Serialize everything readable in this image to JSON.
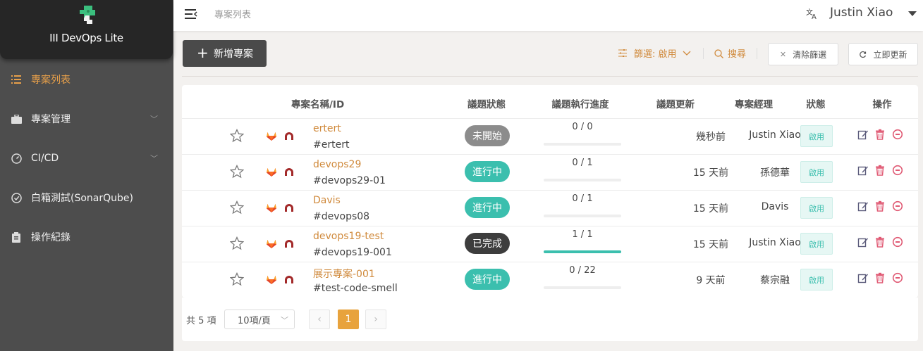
{
  "app": {
    "title": "III DevOps Lite"
  },
  "sidebar": {
    "items": [
      {
        "label": "專案列表",
        "icon": "list-icon",
        "active": true
      },
      {
        "label": "專案管理",
        "icon": "briefcase-icon",
        "expandable": true
      },
      {
        "label": "CI/CD",
        "icon": "gauge-icon",
        "expandable": true
      },
      {
        "label": "白箱測試(SonarQube)",
        "icon": "check-circle-icon"
      },
      {
        "label": "操作紀錄",
        "icon": "clipboard-icon"
      }
    ]
  },
  "header": {
    "breadcrumb": "專案列表",
    "user": "Justin Xiao"
  },
  "toolbar": {
    "add_label": "新增專案",
    "filter_label": "篩選: 啟用",
    "search_label": "搜尋",
    "clear_label": "清除篩選",
    "refresh_label": "立即更新"
  },
  "table": {
    "columns": [
      "專案名稱/ID",
      "議題狀態",
      "議題執行進度",
      "議題更新",
      "專案經理",
      "狀態",
      "操作"
    ],
    "rows": [
      {
        "name": "ertert",
        "id": "#ertert",
        "status": "未開始",
        "status_color": "#8c8c8c",
        "progress": "0 / 0",
        "progress_ratio": 0,
        "updated": "幾秒前",
        "manager": "Justin Xiao",
        "state": "啟用"
      },
      {
        "name": "devops29",
        "id": "#devops29-01",
        "status": "進行中",
        "status_color": "#3bbfae",
        "progress": "0 / 1",
        "progress_ratio": 0,
        "updated": "15 天前",
        "manager": "孫德華",
        "state": "啟用"
      },
      {
        "name": "Davis",
        "id": "#devops08",
        "status": "進行中",
        "status_color": "#3bbfae",
        "progress": "0 / 1",
        "progress_ratio": 0,
        "updated": "15 天前",
        "manager": "Davis",
        "state": "啟用"
      },
      {
        "name": "devops19-test",
        "id": "#devops19-001",
        "status": "已完成",
        "status_color": "#3d3d3d",
        "progress": "1 / 1",
        "progress_ratio": 1,
        "updated": "15 天前",
        "manager": "Justin Xiao",
        "state": "啟用"
      },
      {
        "name": "展示專案-001",
        "id": "#test-code-smell",
        "status": "進行中",
        "status_color": "#3bbfae",
        "progress": "0 / 22",
        "progress_ratio": 0,
        "updated": "9 天前",
        "manager": "蔡宗融",
        "state": "啟用"
      }
    ]
  },
  "pagination": {
    "total": "共 5 項",
    "page_size": "10項/頁",
    "current_page": "1"
  },
  "colors": {
    "accent": "#e8a33d",
    "link": "#d08a3c",
    "teal": "#3bbfae",
    "delete": "#e05a74",
    "sidebar": "#4d4d4d"
  }
}
